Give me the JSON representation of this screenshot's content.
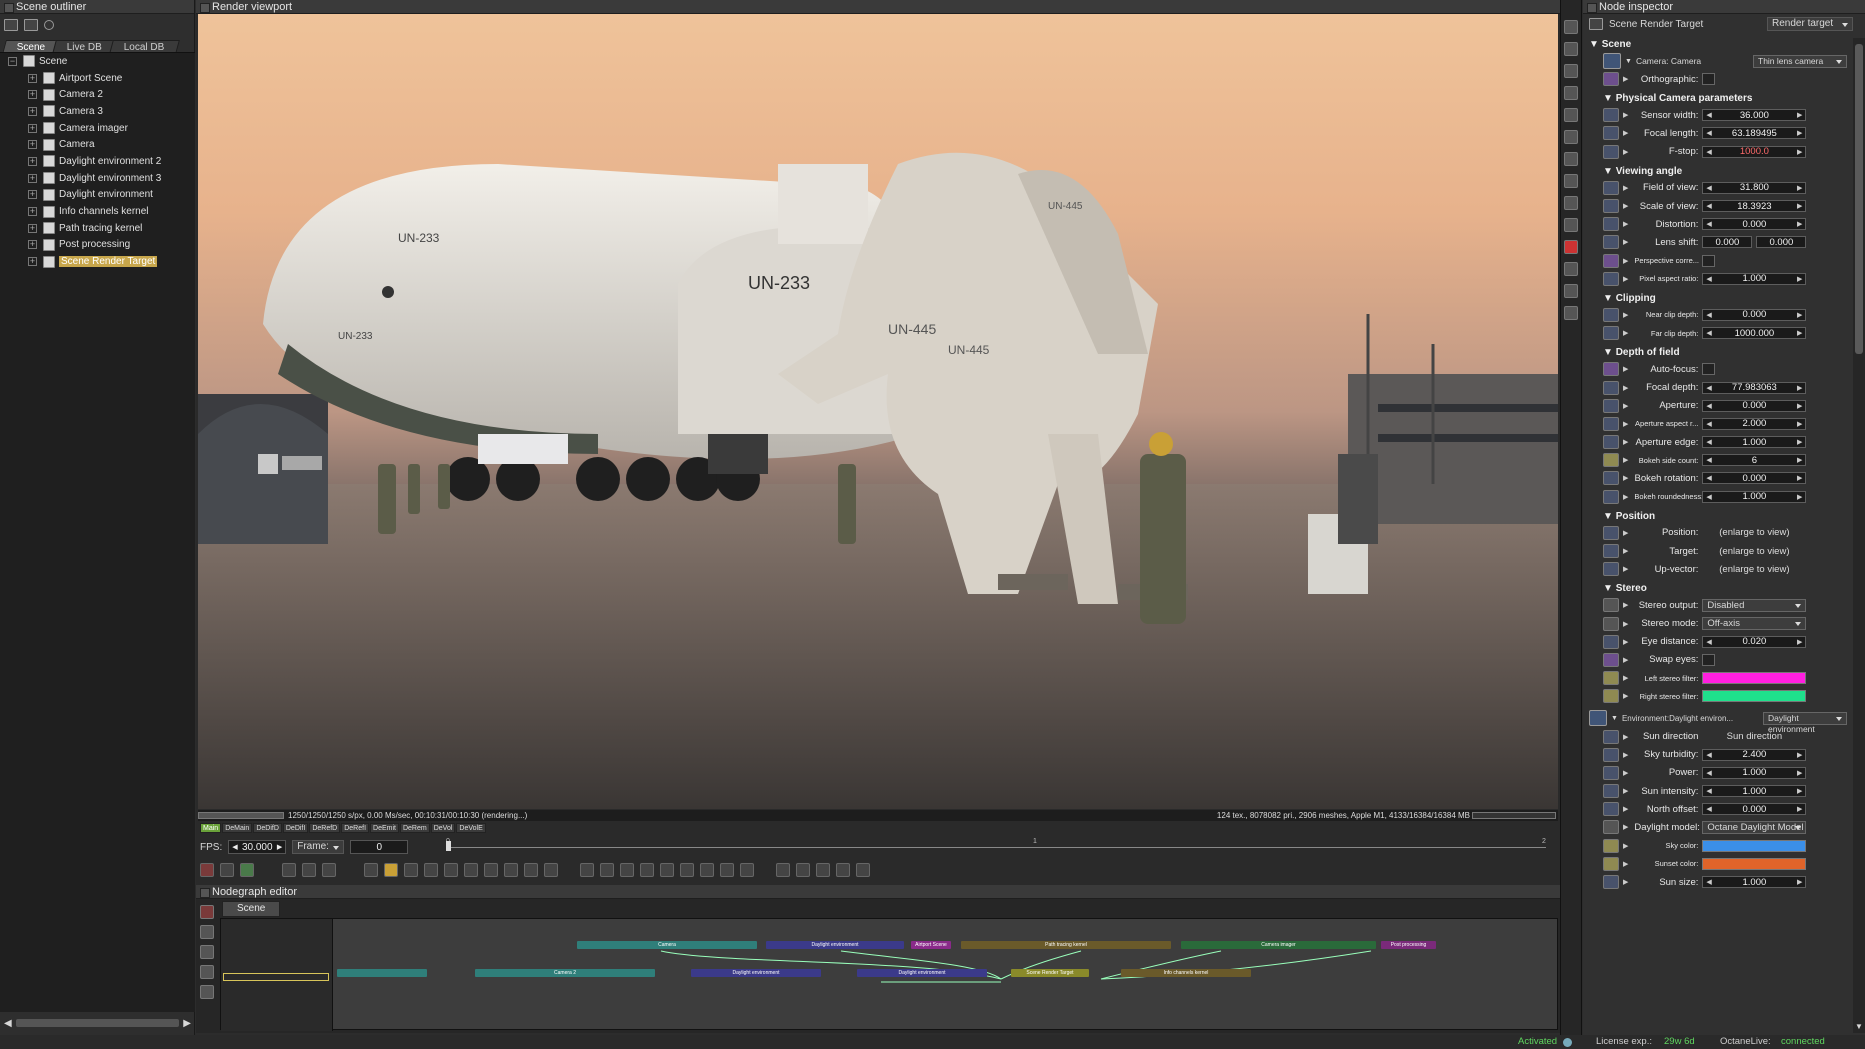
{
  "outliner": {
    "title": "Scene outliner",
    "tabs": [
      "Scene",
      "Live DB",
      "Local DB"
    ],
    "root": "Scene",
    "items": [
      {
        "label": "Airtport Scene",
        "icon": "geometry-icon"
      },
      {
        "label": "Camera 2",
        "icon": "camera-icon"
      },
      {
        "label": "Camera 3",
        "icon": "camera-icon"
      },
      {
        "label": "Camera imager",
        "icon": "imager-icon"
      },
      {
        "label": "Camera",
        "icon": "camera-icon"
      },
      {
        "label": "Daylight environment 2",
        "icon": "environment-icon"
      },
      {
        "label": "Daylight environment 3",
        "icon": "environment-icon"
      },
      {
        "label": "Daylight environment",
        "icon": "environment-icon"
      },
      {
        "label": "Info channels kernel",
        "icon": "kernel-icon"
      },
      {
        "label": "Path tracing kernel",
        "icon": "kernel-icon"
      },
      {
        "label": "Post processing",
        "icon": "postprocess-icon"
      },
      {
        "label": "Scene Render Target",
        "icon": "render-target-icon",
        "selected": true
      }
    ]
  },
  "viewport": {
    "title": "Render viewport",
    "status_left": "1250/1250/1250 s/px, 0.00 Ms/sec, 00:10:31/00:10:30 (rendering...)",
    "status_right": "124 tex., 8078082 pri., 2906 meshes, Apple M1, 4133/16384/16384 MB",
    "passes": [
      "Main",
      "DeMain",
      "DeDifD",
      "DeDifI",
      "DeRefD",
      "DeRefI",
      "DeEmit",
      "DeRem",
      "DeVol",
      "DeVolE"
    ],
    "active_pass": "Main",
    "fps_label": "FPS:",
    "fps_value": "30.000",
    "frame_label": "Frame:",
    "frame_value": "0",
    "timeline_ticks": [
      "0",
      "1",
      "2"
    ],
    "render_labels": {
      "plane_tail": "UN-233",
      "plane_side": "UN-233",
      "plane_nose": "UN-233",
      "robot_chest": "UN-445",
      "robot_leg": "UN-445",
      "robot_back": "UN-445"
    }
  },
  "nodegraph": {
    "title": "Nodegraph editor",
    "tab": "Scene",
    "nodes": [
      {
        "label": "Camera",
        "color": "#2f7f7a"
      },
      {
        "label": "Daylight environment",
        "color": "#3b3a8a"
      },
      {
        "label": "Airtport Scene",
        "color": "#8a2a8a"
      },
      {
        "label": "Path tracing kernel",
        "color": "#6a5a2a"
      },
      {
        "label": "Camera imager",
        "color": "#2a6a3a"
      },
      {
        "label": "Post processing",
        "color": "#7a2a7a"
      },
      {
        "label": "",
        "color": "#2f7f7a"
      },
      {
        "label": "Camera 2",
        "color": "#2f7f7a"
      },
      {
        "label": "Daylight environment",
        "color": "#3b3a8a"
      },
      {
        "label": "Daylight environment",
        "color": "#3b3a8a"
      },
      {
        "label": "Scene Render Target",
        "color": "#8a8a2a"
      },
      {
        "label": "Info channels kernel",
        "color": "#6a5a2a"
      }
    ]
  },
  "inspector": {
    "title": "Node inspector",
    "node_name": "Scene Render Target",
    "node_type": "Render target",
    "scene_section": "Scene",
    "camera_label": "Camera: Camera",
    "camera_type": "Thin lens camera",
    "orthographic_label": "Orthographic:",
    "sections": {
      "physical": "Physical Camera parameters",
      "viewing": "Viewing angle",
      "clipping": "Clipping",
      "dof": "Depth of field",
      "position": "Position",
      "stereo": "Stereo"
    },
    "physical": [
      {
        "label": "Sensor width:",
        "value": "36.000"
      },
      {
        "label": "Focal length:",
        "value": "63.189495"
      },
      {
        "label": "F-stop:",
        "value": "1000.0"
      }
    ],
    "viewing": [
      {
        "label": "Field of view:",
        "value": "31.800"
      },
      {
        "label": "Scale of view:",
        "value": "18.3923"
      },
      {
        "label": "Distortion:",
        "value": "0.000"
      }
    ],
    "lens_shift": {
      "label": "Lens shift:",
      "x": "0.000",
      "y": "0.000"
    },
    "perspective": "Perspective corre...",
    "pixel_aspect": {
      "label": "Pixel aspect ratio:",
      "value": "1.000"
    },
    "clipping": [
      {
        "label": "Near clip depth:",
        "value": "0.000"
      },
      {
        "label": "Far clip depth:",
        "value": "1000.000"
      }
    ],
    "autofocus": "Auto-focus:",
    "dof": [
      {
        "label": "Focal depth:",
        "value": "77.983063"
      },
      {
        "label": "Aperture:",
        "value": "0.000"
      },
      {
        "label": "Aperture aspect r...",
        "value": "2.000"
      },
      {
        "label": "Aperture edge:",
        "value": "1.000"
      },
      {
        "label": "Bokeh side count:",
        "value": "6"
      },
      {
        "label": "Bokeh rotation:",
        "value": "0.000"
      },
      {
        "label": "Bokeh roundedness:",
        "value": "1.000"
      }
    ],
    "position": [
      {
        "label": "Position:",
        "value": "(enlarge to view)"
      },
      {
        "label": "Target:",
        "value": "(enlarge to view)"
      },
      {
        "label": "Up-vector:",
        "value": "(enlarge to view)"
      }
    ],
    "stereo_output": {
      "label": "Stereo output:",
      "value": "Disabled"
    },
    "stereo_mode": {
      "label": "Stereo mode:",
      "value": "Off-axis"
    },
    "eye_distance": {
      "label": "Eye distance:",
      "value": "0.020"
    },
    "swap_eyes": "Swap eyes:",
    "left_filter": {
      "label": "Left stereo filter:",
      "color": "#ff1fe0"
    },
    "right_filter": {
      "label": "Right stereo filter:",
      "color": "#1fe08c"
    },
    "environment_label": "Environment:Daylight environ...",
    "environment_type": "Daylight environment",
    "env_rows": [
      {
        "label": "Sun direction",
        "value": "Sun direction",
        "kind": "text"
      },
      {
        "label": "Sky turbidity:",
        "value": "2.400",
        "kind": "num"
      },
      {
        "label": "Power:",
        "value": "1.000",
        "kind": "num"
      },
      {
        "label": "Sun intensity:",
        "value": "1.000",
        "kind": "num"
      },
      {
        "label": "North offset:",
        "value": "0.000",
        "kind": "num"
      }
    ],
    "daylight_model": {
      "label": "Daylight model:",
      "value": "Octane Daylight Model"
    },
    "sky_color": {
      "label": "Sky color:",
      "color": "#3b8fe8"
    },
    "sunset_color": {
      "label": "Sunset color:",
      "color": "#e0642a"
    },
    "sun_size": {
      "label": "Sun size:",
      "value": "1.000"
    }
  },
  "footer": {
    "activated": "Activated",
    "license_label": "License exp.:",
    "license_value": "29w 6d",
    "live_label": "OctaneLive:",
    "live_value": "connected"
  }
}
